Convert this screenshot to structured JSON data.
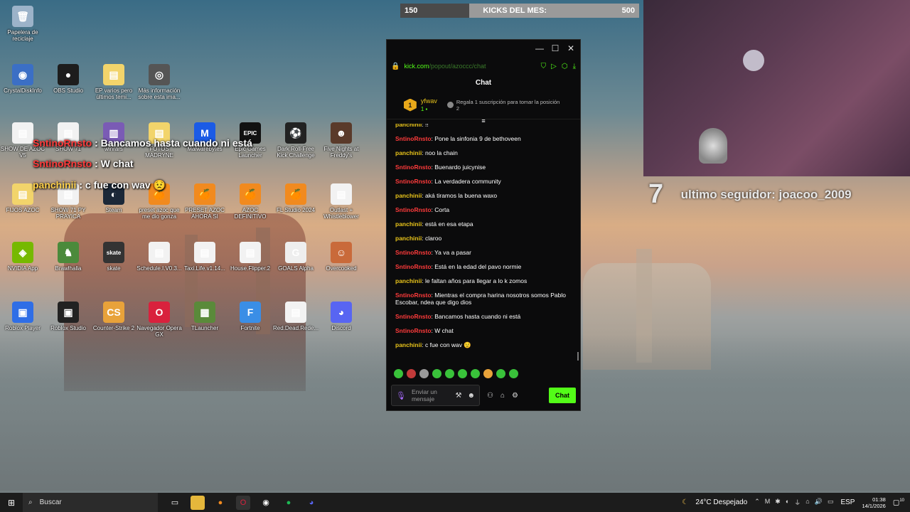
{
  "desktop": {
    "icons": [
      {
        "label": "Papelera de reciclaje",
        "glyph": "🗑",
        "color": "#9cb3c9"
      },
      {
        "label": "CrystalDiskInfo",
        "glyph": "◉",
        "color": "#3b6fc5"
      },
      {
        "label": "OBS Studio",
        "glyph": "●",
        "color": "#1d1d1d"
      },
      {
        "label": "EP varios pero últimos temi...",
        "glyph": "▤",
        "color": "#f2d46b"
      },
      {
        "label": "Más información sobre esta ima...",
        "glyph": "◎",
        "color": "#555"
      },
      {
        "label": "SHOW DE AZOC V5",
        "glyph": "▤",
        "color": "#f2f2f2"
      },
      {
        "label": "SHOW 71",
        "glyph": "▤",
        "color": "#f2f2f2"
      },
      {
        "label": "winrars",
        "glyph": "▥",
        "color": "#7a5bb5"
      },
      {
        "label": "FOTOS MADRYNE",
        "glyph": "▤",
        "color": "#f2d46b"
      },
      {
        "label": "Malwarebytes",
        "glyph": "M",
        "color": "#1b5be6"
      },
      {
        "label": "Epic Games Launcher",
        "glyph": "EPIC",
        "color": "#111"
      },
      {
        "label": "Dark Roll-Free Kick Challenge",
        "glyph": "⚽",
        "color": "#222"
      },
      {
        "label": "Five Nights at Freddy's",
        "glyph": "☻",
        "color": "#5a3a2a"
      },
      {
        "label": "FIJOS AZOC",
        "glyph": "▤",
        "color": "#f2d46b"
      },
      {
        "label": "SHOW 71 PY PRAYICA",
        "glyph": "▤",
        "color": "#f2f2f2"
      },
      {
        "label": "Steam",
        "glyph": "◐",
        "color": "#1b2838"
      },
      {
        "label": "preset azoc que me dio gonza",
        "glyph": "🍊",
        "color": "#f18a1f"
      },
      {
        "label": "PRESET AZOC AHORA SI",
        "glyph": "🍊",
        "color": "#f18a1f"
      },
      {
        "label": "AZOC DEFINITIVO",
        "glyph": "🍊",
        "color": "#f18a1f"
      },
      {
        "label": "FL Studio 2024",
        "glyph": "🍊",
        "color": "#f18a1f"
      },
      {
        "label": "Outlast + Whistleblower",
        "glyph": "▤",
        "color": "#f2f2f2"
      },
      {
        "label": "NVIDIA App",
        "glyph": "◈",
        "color": "#76b900"
      },
      {
        "label": "Brawlhalla",
        "glyph": "♞",
        "color": "#4b8a3b"
      },
      {
        "label": "skate",
        "glyph": "skate",
        "color": "#333"
      },
      {
        "label": "Schedule.I.V0.3...",
        "glyph": "▤",
        "color": "#f2f2f2"
      },
      {
        "label": "Taxi.Life.v1.14...",
        "glyph": "▤",
        "color": "#f2f2f2"
      },
      {
        "label": "House.Flipper.2",
        "glyph": "▤",
        "color": "#f2f2f2"
      },
      {
        "label": "GOALS Alpha",
        "glyph": "G",
        "color": "#eee"
      },
      {
        "label": "Overcooked",
        "glyph": "☺",
        "color": "#c96a3a"
      },
      {
        "label": "Roblox Player",
        "glyph": "▣",
        "color": "#2f6ee6"
      },
      {
        "label": "Roblox Studio",
        "glyph": "▣",
        "color": "#222"
      },
      {
        "label": "Counter-Strike 2",
        "glyph": "CS",
        "color": "#e8a23a"
      },
      {
        "label": "Navegador Opera GX",
        "glyph": "O",
        "color": "#d9213d"
      },
      {
        "label": "TLauncher",
        "glyph": "▦",
        "color": "#5a8a3a"
      },
      {
        "label": "Fortnite",
        "glyph": "F",
        "color": "#3a8ee6"
      },
      {
        "label": "Red.Dead.Rede...",
        "glyph": "▤",
        "color": "#f2f2f2"
      },
      {
        "label": "Discord",
        "glyph": "◕",
        "color": "#5865f2"
      }
    ]
  },
  "overlay": {
    "lines": [
      {
        "user": "SntinoRnsto",
        "sep": " : ",
        "text": "Bancamos hasta cuando ni está"
      },
      {
        "user": "SntinoRnsto",
        "sep": " : ",
        "text": "W chat"
      },
      {
        "user": "panchinii",
        "sep": " : ",
        "text": "c fue con wav 😟"
      }
    ]
  },
  "kicks_bar": {
    "current": "150",
    "label": "KICKS DEL MES:",
    "goal": "500",
    "progress": 0.29
  },
  "stream": {
    "follower_number": "7",
    "follower_text": "ultimo seguidor: joacoo_2009"
  },
  "chat_window": {
    "url_host": "kick.com",
    "url_path": "/popout/azoccc/chat",
    "title": "Chat",
    "top_sub": {
      "rank": "1",
      "user": "yfwav",
      "count": "1",
      "gift_text": "Regala 1 suscripción para tomar la posición 2"
    },
    "messages": [
      {
        "user": "panchinii",
        "color": "yel",
        "text": "!!"
      },
      {
        "user": "SntinoRnsto",
        "color": "red",
        "text": "Pone la sinfonia 9 de bethoveen"
      },
      {
        "user": "panchinii",
        "color": "yel",
        "text": "noo la chain"
      },
      {
        "user": "SntinoRnsto",
        "color": "red",
        "text": "Buenardo juicynise"
      },
      {
        "user": "SntinoRnsto",
        "color": "red",
        "text": "La verdadera community"
      },
      {
        "user": "panchinii",
        "color": "yel",
        "text": "aká tiramos la buena waxo"
      },
      {
        "user": "SntinoRnsto",
        "color": "red",
        "text": "Corta"
      },
      {
        "user": "panchinii",
        "color": "yel",
        "text": "está en esa etapa"
      },
      {
        "user": "panchinii",
        "color": "yel",
        "text": "claroo"
      },
      {
        "user": "SntinoRnsto",
        "color": "red",
        "text": "Ya va a pasar"
      },
      {
        "user": "SntinoRnsto",
        "color": "red",
        "text": "Está en la edad del pavo normie"
      },
      {
        "user": "panchinii",
        "color": "yel",
        "text": "le faltan años para llegar a lo k zomos"
      },
      {
        "user": "SntinoRnsto",
        "color": "red",
        "text": "Mientras el compra harina nosotros somos Pablo Escobar, ndea que digo dios"
      },
      {
        "user": "SntinoRnsto",
        "color": "red",
        "text": "Bancamos hasta cuando ni está"
      },
      {
        "user": "SntinoRnsto",
        "color": "red",
        "text": "W chat"
      },
      {
        "user": "panchinii",
        "color": "yel",
        "text": "c fue con wav 😟"
      }
    ],
    "input_placeholder": "Enviar un mensaje",
    "send_label": "Chat"
  },
  "taskbar": {
    "search_placeholder": "Buscar",
    "weather": "24°C Despejado",
    "language": "ESP",
    "time": "01:38",
    "date": "14/1/2026",
    "notification_count": "10"
  }
}
